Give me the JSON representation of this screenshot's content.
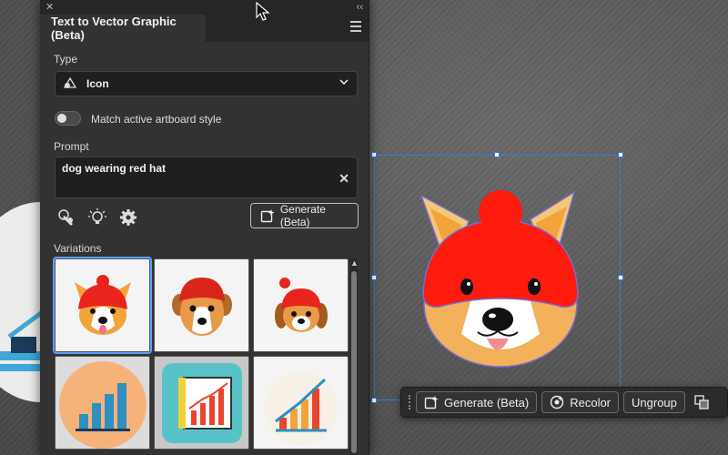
{
  "panel": {
    "title": "Text to Vector Graphic (Beta)",
    "close_glyph": "✕",
    "collapse_glyph": "‹‹",
    "menu_icon": "hamburger-menu-icon"
  },
  "type_section": {
    "label": "Type",
    "selected_value": "Icon",
    "icon": "icon-type-icon"
  },
  "toggle": {
    "label": "Match active artboard style",
    "state": "off"
  },
  "prompt": {
    "label": "Prompt",
    "value": "dog wearing red hat",
    "clear_glyph": "✕"
  },
  "tools": {
    "generate_label": "Generate (Beta)",
    "icons": [
      "style-picker-icon",
      "suggestions-bulb-icon",
      "settings-gear-icon"
    ]
  },
  "variations": {
    "label": "Variations",
    "items": [
      {
        "kind": "dog-icon",
        "desc_color": "#e8251c"
      },
      {
        "kind": "dog-icon",
        "desc_color": "#d9261c"
      },
      {
        "kind": "dog-icon",
        "desc_color": "#e8251c"
      },
      {
        "kind": "chart-icon",
        "desc_color": "#f7b27a"
      },
      {
        "kind": "chart-icon",
        "desc_color": "#58c2c9"
      },
      {
        "kind": "chart-icon",
        "desc_color": "#f6f0e6"
      }
    ]
  },
  "contextual_bar": {
    "generate_label": "Generate (Beta)",
    "recolor_label": "Recolor",
    "ungroup_label": "Ungroup"
  },
  "colors": {
    "panel_bg": "#323232",
    "accent_blue": "#3a7bd5",
    "hat_red": "#ff1a0e",
    "fur_orange": "#f7c060"
  }
}
